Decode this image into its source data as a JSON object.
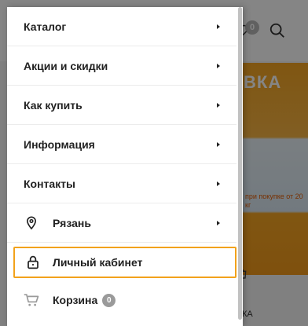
{
  "background": {
    "banner_text": "ВКА",
    "banner_note": "при покупке от 20 кг",
    "cart_badge_count": "0",
    "bottom_text": "КА"
  },
  "menu": {
    "items": [
      {
        "label": "Каталог"
      },
      {
        "label": "Акции и скидки"
      },
      {
        "label": "Как купить"
      },
      {
        "label": "Информация"
      },
      {
        "label": "Контакты"
      },
      {
        "label": "Рязань",
        "icon": "map-pin-icon"
      },
      {
        "label": "Личный кабинет",
        "icon": "lock-icon"
      },
      {
        "label": "Корзина",
        "icon": "cart-icon",
        "badge": "0"
      }
    ]
  },
  "colors": {
    "highlight_border": "#f2a21b",
    "badge": "#9a9a9a"
  }
}
